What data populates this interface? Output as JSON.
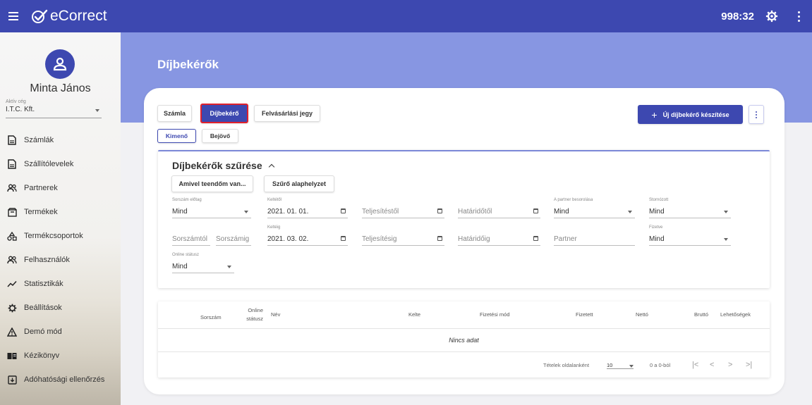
{
  "app": {
    "name": "eCorrect",
    "timer": "998:32"
  },
  "user": {
    "name": "Minta János",
    "company_label": "Aktív cég",
    "company_value": "I.T.C. Kft."
  },
  "sidebar": {
    "items": [
      {
        "label": "Számlák",
        "icon": "document-icon"
      },
      {
        "label": "Szállítólevelek",
        "icon": "document-icon"
      },
      {
        "label": "Partnerek",
        "icon": "people-icon"
      },
      {
        "label": "Termékek",
        "icon": "box-icon"
      },
      {
        "label": "Termékcsoportok",
        "icon": "category-icon"
      },
      {
        "label": "Felhasználók",
        "icon": "people-icon"
      },
      {
        "label": "Statisztikák",
        "icon": "chart-line-icon"
      },
      {
        "label": "Beállítások",
        "icon": "gear-icon"
      },
      {
        "label": "Demó mód",
        "icon": "warning-icon"
      },
      {
        "label": "Kézikönyv",
        "icon": "book-icon"
      },
      {
        "label": "Adóhatósági ellenőrzés",
        "icon": "download-box-icon"
      }
    ]
  },
  "page": {
    "title": "Díjbekérők"
  },
  "doc_tabs": {
    "szamla": "Számla",
    "dijbekero": "Díjbekérő",
    "felvasarlasi": "Felvásárlási jegy"
  },
  "direction_tabs": {
    "kimeno": "Kimenő",
    "bejovo": "Bejövő"
  },
  "actions": {
    "new_label": "Új díjbekérő készítése"
  },
  "filter": {
    "title": "Díjbekérők szűrése",
    "todo_button": "Amivel teendőm van...",
    "reset_button": "Szűrő alaphelyzet",
    "prefix": {
      "label": "Sorszám előtag",
      "value": "Mind"
    },
    "date_from": {
      "label": "Keltétől",
      "value": "2021. 01. 01."
    },
    "fulfil_from": {
      "placeholder": "Teljesítéstől"
    },
    "due_from": {
      "placeholder": "Határidőtől"
    },
    "partner_class": {
      "label": "A partner besorolása",
      "value": "Mind"
    },
    "cancelled": {
      "label": "Stornózott",
      "value": "Mind"
    },
    "number_from": {
      "placeholder": "Sorszámtól"
    },
    "number_to": {
      "placeholder": "Sorszámig"
    },
    "date_to": {
      "label": "Keltéig",
      "value": "2021. 03. 02."
    },
    "fulfil_to": {
      "placeholder": "Teljesítésig"
    },
    "due_to": {
      "placeholder": "Határidőig"
    },
    "partner": {
      "placeholder": "Partner"
    },
    "paid": {
      "label": "Fizetve",
      "value": "Mind"
    },
    "online_status": {
      "label": "Online státusz",
      "value": "Mind"
    }
  },
  "table": {
    "columns": {
      "sorszam": "Sorszám",
      "online_1": "Online",
      "online_2": "státusz",
      "nev": "Név",
      "kelte": "Kelte",
      "fizetesi_mod": "Fizetési mód",
      "fizetett": "Fizetett",
      "netto": "Nettó",
      "brutto": "Bruttó",
      "lehetosegek": "Lehetőségek"
    },
    "empty_text": "Nincs adat",
    "pager": {
      "rows_label": "Tételek oldalanként",
      "rows_value": "10",
      "range": "0 a 0-ból"
    }
  },
  "colors": {
    "primary": "#3d48b0",
    "hero": "#8796e2",
    "active_outline": "#e0202c"
  }
}
